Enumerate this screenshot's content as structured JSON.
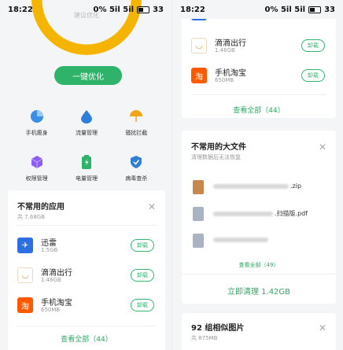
{
  "left": {
    "status": {
      "time": "18:22",
      "signal": "0% 5il 5il",
      "battery": "33"
    },
    "gauge_label": "建议优化",
    "optimize_button": "一键优化",
    "tools": [
      {
        "label": "手机瘦身",
        "icon": "pie-chart-icon",
        "color": "#3a8ee6"
      },
      {
        "label": "流量管理",
        "icon": "water-drop-icon",
        "color": "#2f7ed8"
      },
      {
        "label": "骚扰拦截",
        "icon": "umbrella-icon",
        "color": "#f2a516"
      },
      {
        "label": "权限管理",
        "icon": "cube-icon",
        "color": "#8b5cf6"
      },
      {
        "label": "电量管理",
        "icon": "battery-icon",
        "color": "#2fb36a"
      },
      {
        "label": "病毒查杀",
        "icon": "shield-icon",
        "color": "#2f7ed8"
      }
    ],
    "apps_card": {
      "title": "不常用的应用",
      "subtitle": "共 7.68GB",
      "apps": [
        {
          "name": "迅雷",
          "size": "1.5GB",
          "icon": "xunlei-icon",
          "color": "#2d6ee0",
          "glyph": "✈"
        },
        {
          "name": "滴滴出行",
          "size": "1.46GB",
          "icon": "didi-icon",
          "color": "#ffffff",
          "glyph": "◡"
        },
        {
          "name": "手机淘宝",
          "size": "650MB",
          "icon": "taobao-icon",
          "color": "#ff5a00",
          "glyph": "淘"
        }
      ],
      "uninstall_label": "卸载",
      "view_all": "查看全部（44）"
    }
  },
  "right": {
    "status": {
      "time": "18:22",
      "signal": "0% 5il 5il",
      "battery": "33"
    },
    "apps": [
      {
        "name": "迅雷",
        "size": "1.5GB",
        "icon": "xunlei-icon",
        "color": "#2d6ee0",
        "glyph": "✈"
      },
      {
        "name": "滴滴出行",
        "size": "1.46GB",
        "icon": "didi-icon",
        "color": "#ffffff",
        "glyph": "◡"
      },
      {
        "name": "手机淘宝",
        "size": "650MB",
        "icon": "taobao-icon",
        "color": "#ff5a00",
        "glyph": "淘"
      }
    ],
    "uninstall_label": "卸载",
    "view_all": "查看全部（44）",
    "files_card": {
      "title": "不常用的大文件",
      "subtitle": "清理数据后无法恢复",
      "files": [
        {
          "ext": ".zip",
          "icon": "zip-file-icon",
          "color": "#c9874e"
        },
        {
          "ext": ".扫描版.pdf",
          "icon": "document-icon",
          "color": "#a9b3c2"
        },
        {
          "ext": "",
          "icon": "document-icon",
          "color": "#a9b3c2"
        }
      ],
      "view_all": "查看全部（49）",
      "clean_button": "立即清理 1.42GB"
    },
    "photos_card": {
      "title": "92 组相似图片",
      "subtitle": "共 875MB"
    }
  }
}
